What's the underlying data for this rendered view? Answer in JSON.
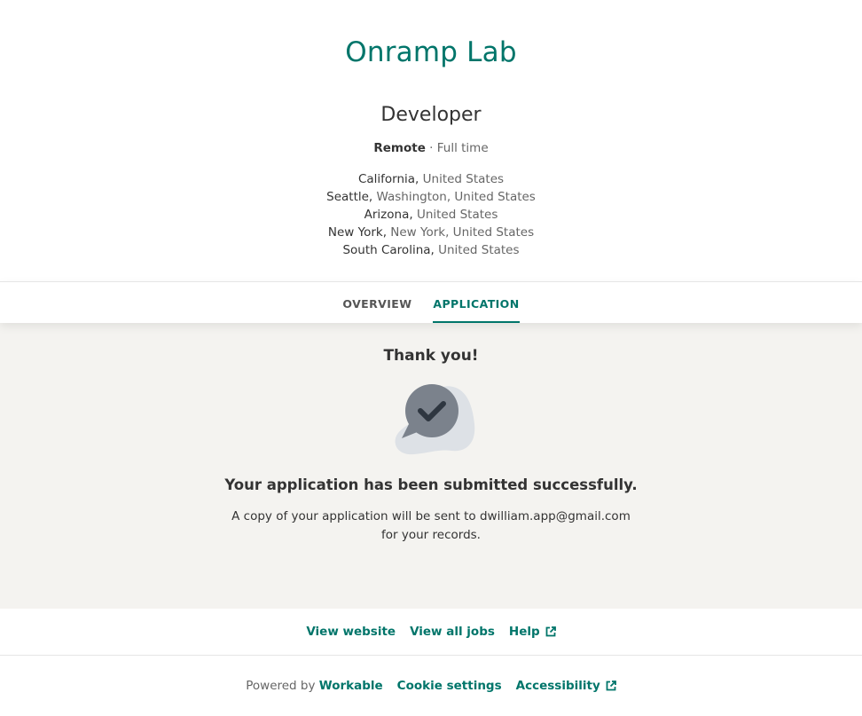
{
  "header": {
    "company": "Onramp Lab",
    "job_title": "Developer",
    "workplace": "Remote",
    "separator": "·",
    "employment_type": "Full time",
    "locations": [
      {
        "city": "California,",
        "rest": "United States"
      },
      {
        "city": "Seattle,",
        "rest": "Washington, United States"
      },
      {
        "city": "Arizona,",
        "rest": "United States"
      },
      {
        "city": "New York,",
        "rest": "New York, United States"
      },
      {
        "city": "South Carolina,",
        "rest": "United States"
      }
    ]
  },
  "tabs": [
    {
      "label": "OVERVIEW",
      "active": false
    },
    {
      "label": "APPLICATION",
      "active": true
    }
  ],
  "confirmation": {
    "heading": "Thank you!",
    "icon": "check-chat-bubble-icon",
    "message": "Your application has been submitted successfully.",
    "note": "A copy of your application will be sent to dwilliam.app@gmail.com for your records."
  },
  "links": {
    "view_website": "View website",
    "view_all_jobs": "View all jobs",
    "help": "Help"
  },
  "footer": {
    "powered_by": "Powered by",
    "brand": "Workable",
    "cookie_settings": "Cookie settings",
    "accessibility": "Accessibility"
  },
  "colors": {
    "brand": "#00756a",
    "content_bg": "#f4f3f0",
    "icon_dark": "#7b828c",
    "icon_light": "#dde1e6"
  }
}
